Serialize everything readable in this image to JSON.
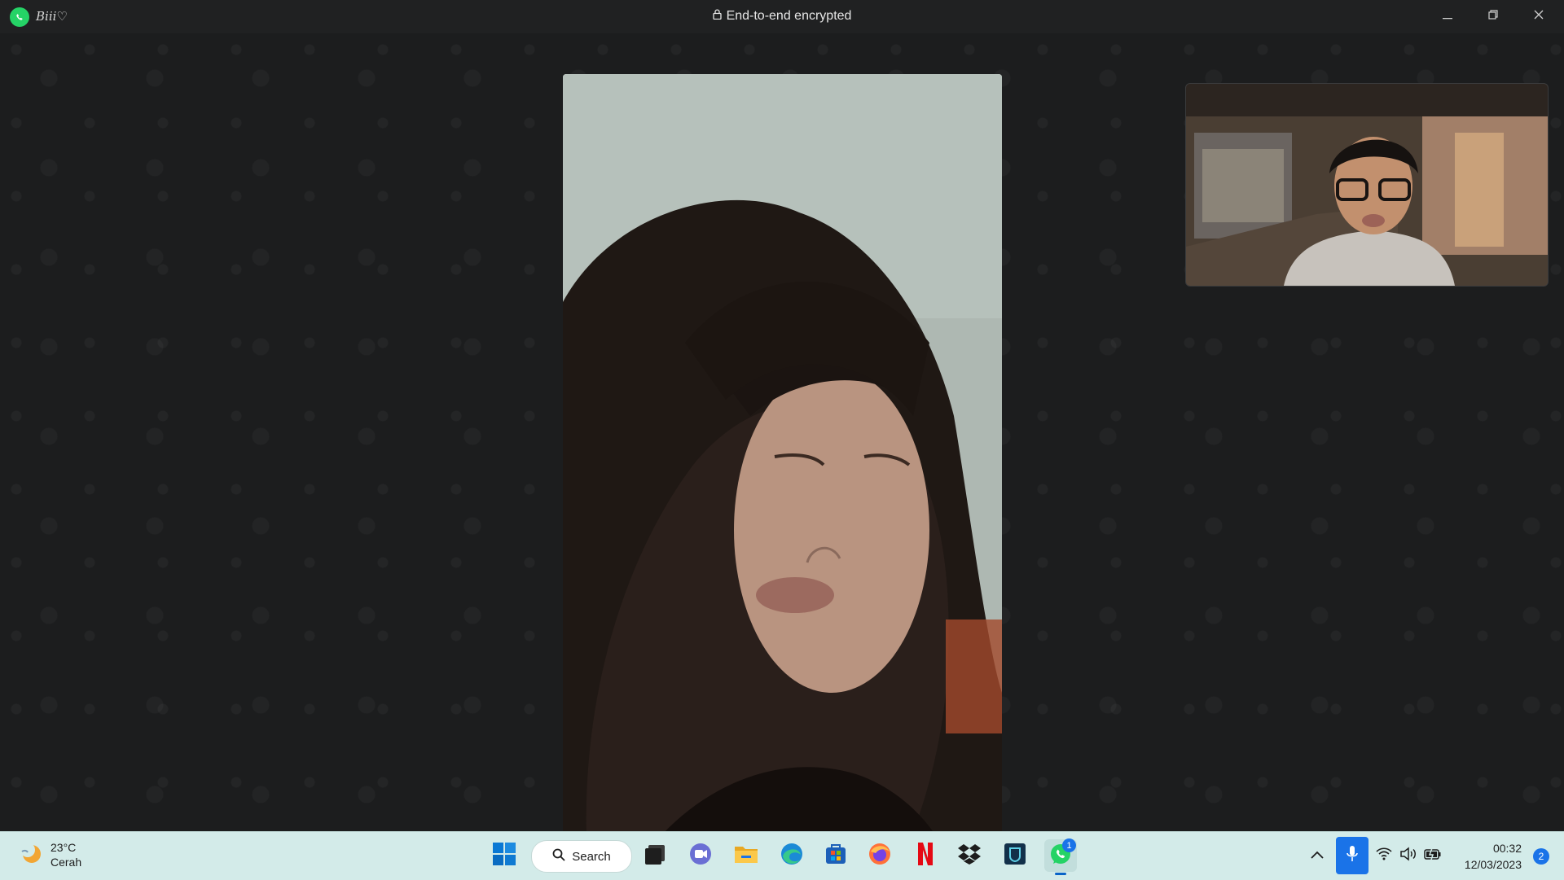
{
  "window": {
    "caller_name": "Biii♡",
    "encryption_label": "End-to-end encrypted",
    "controls": [
      "minimize-icon",
      "restore-icon",
      "close-icon"
    ]
  },
  "call": {
    "main_video": "remote-participant-video",
    "self_view": "local-camera-preview"
  },
  "taskbar": {
    "weather": {
      "temperature": "23°C",
      "condition": "Cerah"
    },
    "search_label": "Search",
    "pinned_apps": [
      {
        "name": "start",
        "icon": "windows-start-icon"
      },
      {
        "name": "task-view",
        "icon": "task-view-icon"
      },
      {
        "name": "chat",
        "icon": "teams-chat-icon"
      },
      {
        "name": "file-explorer",
        "icon": "folder-icon"
      },
      {
        "name": "edge",
        "icon": "edge-icon"
      },
      {
        "name": "store",
        "icon": "store-icon"
      },
      {
        "name": "firefox",
        "icon": "firefox-icon"
      },
      {
        "name": "netflix",
        "icon": "netflix-icon"
      },
      {
        "name": "dropbox",
        "icon": "dropbox-icon"
      },
      {
        "name": "app",
        "icon": "app-icon"
      },
      {
        "name": "whatsapp",
        "icon": "whatsapp-icon",
        "badge": "1",
        "active": true
      }
    ],
    "tray": {
      "time": "00:32",
      "date": "12/03/2023",
      "notification_count": "2"
    }
  },
  "colors": {
    "whatsapp_green": "#25d366",
    "taskbar_bg": "#d3ebe9",
    "accent_blue": "#1a73e8"
  }
}
